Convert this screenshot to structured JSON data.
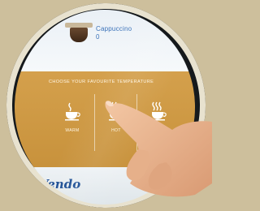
{
  "product": {
    "name": "Cappuccino",
    "price": "0"
  },
  "temperature_panel": {
    "title": "CHOOSE YOUR FAVOURITE TEMPERATURE",
    "options": [
      {
        "label": "WARM",
        "icon": "cup-warm-icon"
      },
      {
        "label": "HOT",
        "icon": "cup-hot-icon"
      },
      {
        "label": "",
        "icon": "cup-very-hot-icon"
      }
    ]
  },
  "brand": {
    "logo_text": "Vendo"
  },
  "colors": {
    "panel": "#cf9a45",
    "brand_blue": "#1e4f95",
    "screen_white": "#f2f6f9"
  }
}
